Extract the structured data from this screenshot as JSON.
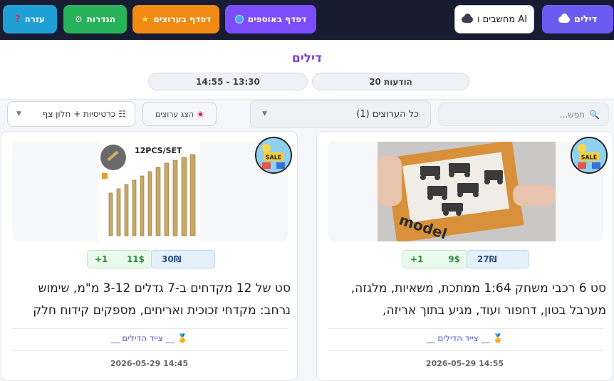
{
  "topbar": {
    "help_label": "עזרה",
    "settings_label": "הגדרות",
    "browse_sellers_label": "דפדף בערוצים",
    "browse_collections_label": "דפדף באוספים",
    "computers_label": "מחשבים ו AI",
    "deals_label": "דילים"
  },
  "header": {
    "title": "דילים",
    "message_count": "20 הודעות",
    "time_range": "14:55 - 13:30"
  },
  "filters": {
    "search_placeholder": "חפש...",
    "sellers_select": "כל הערוצים (1)",
    "show_sellers_label": "הצג ערוצים",
    "view_select": "כרטיסיות + חלון צף"
  },
  "cards": [
    {
      "old_price": "27₪",
      "new_price": "9$",
      "plus": "+1",
      "title": "סט 6 רכבי משחק 1:64 ממתכת, משאיות, מלגזה, מערבל בטון, דחפור ועוד, מגיע בתוך אריזה,",
      "hunter": "__ צייד הדילים __",
      "date": "2026-05-29 14:55",
      "badge_text": "SALE",
      "image_text": "model"
    },
    {
      "old_price": "30₪",
      "new_price": "11$",
      "plus": "+1",
      "title": "סט של 12 מקדחים ב-7 גדלים 3-12 מ\"מ, שימוש נרחב: מקדחי זכוכית ואריחים, מספקים קידוח חלק",
      "hunter": "__ צייד הדילים __",
      "date": "2026-05-29 14:45",
      "badge_text": "SALE",
      "image_text": "12PCS/SET"
    }
  ],
  "colors": {
    "topbar_bg": "#171c33",
    "help": "#1ea0d6",
    "settings": "#26b35a",
    "browse_sellers": "#f08a12",
    "browse_collections": "#7c4dff",
    "deals": "#6a5cf0",
    "title": "#7b3fe4"
  }
}
